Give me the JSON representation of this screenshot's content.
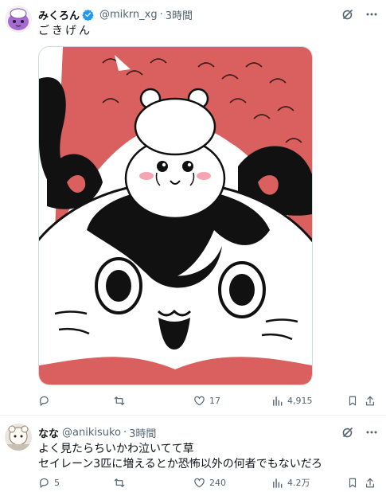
{
  "tweets": [
    {
      "display_name": "みくろん",
      "handle": "@mikrn_xg",
      "separator": "·",
      "time": "3時間",
      "verified": true,
      "text": "ごきげん",
      "stats": {
        "replies": "",
        "reposts": "",
        "likes": "17",
        "views": "4,915"
      }
    },
    {
      "display_name": "なな",
      "handle": "@anikisuko",
      "separator": "·",
      "time": "3時間",
      "verified": false,
      "text_lines": [
        "よく見たらちいかわ泣いてて草",
        "セイレーン3匹に増えるとか恐怖以外の何者でもないだろ"
      ],
      "stats": {
        "replies": "5",
        "reposts": "",
        "likes": "240",
        "views": "4.2万"
      }
    }
  ],
  "icons": [
    "grok-icon",
    "more-icon",
    "reply-icon",
    "repost-icon",
    "like-icon",
    "views-icon",
    "bookmark-icon",
    "share-icon",
    "verified-badge-icon"
  ],
  "colors": {
    "verified": "#1d9bf0",
    "secondary_text": "#536471",
    "media_pink": "#d9605f"
  }
}
